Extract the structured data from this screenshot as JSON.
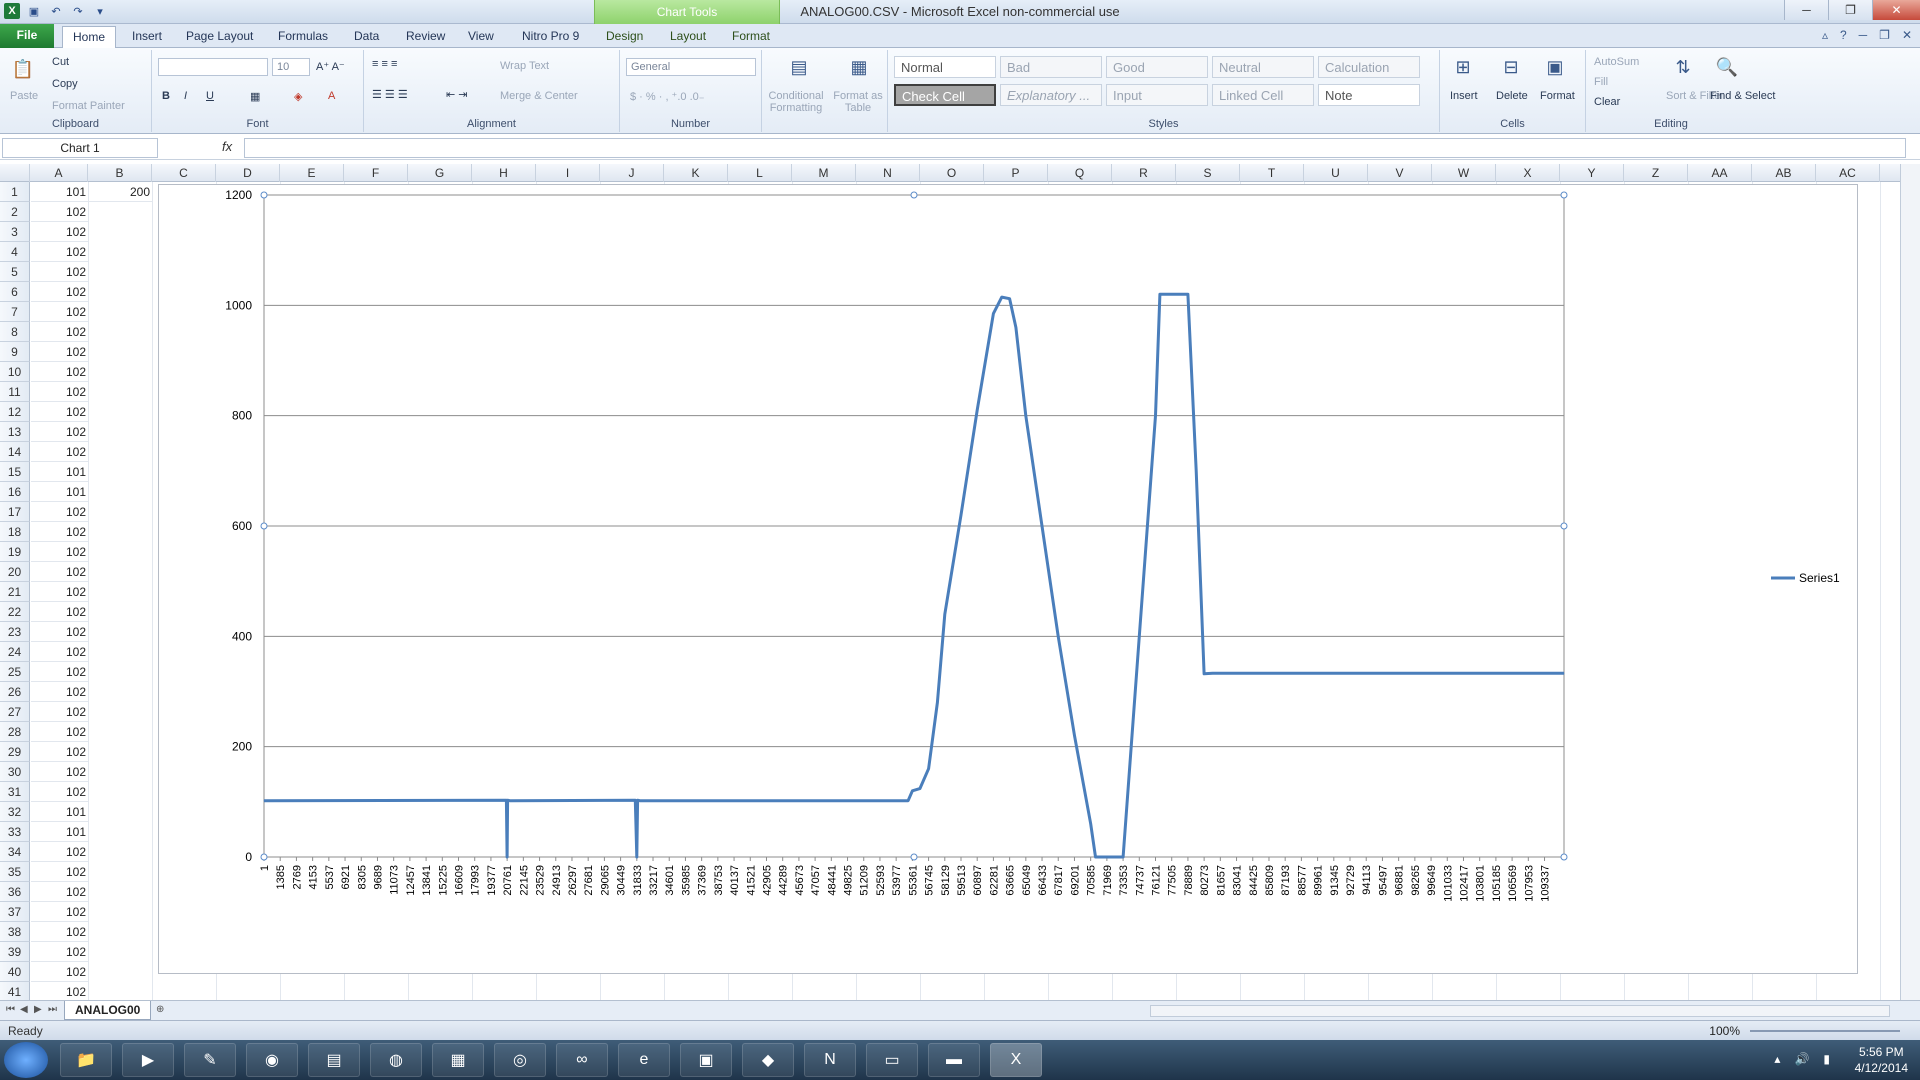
{
  "window": {
    "title": "ANALOG00.CSV - Microsoft Excel non-commercial use",
    "context_tab": "Chart Tools"
  },
  "tabs": [
    "File",
    "Home",
    "Insert",
    "Page Layout",
    "Formulas",
    "Data",
    "Review",
    "View",
    "Nitro Pro 9",
    "Design",
    "Layout",
    "Format"
  ],
  "ribbon": {
    "clipboard": {
      "label": "Clipboard",
      "paste": "Paste",
      "cut": "Cut",
      "copy": "Copy",
      "format_painter": "Format Painter"
    },
    "font": {
      "label": "Font",
      "size": "10"
    },
    "alignment": {
      "label": "Alignment",
      "wrap": "Wrap Text",
      "merge": "Merge & Center"
    },
    "number": {
      "label": "Number",
      "format": "General"
    },
    "cond_format": "Conditional Formatting",
    "format_table": "Format as Table",
    "styles": {
      "label": "Styles",
      "cells": [
        "Normal",
        "Bad",
        "Good",
        "Neutral",
        "Calculation",
        "Check Cell",
        "Explanatory ...",
        "Input",
        "Linked Cell",
        "Note"
      ]
    },
    "cells": {
      "label": "Cells",
      "insert": "Insert",
      "delete": "Delete",
      "format": "Format"
    },
    "editing": {
      "label": "Editing",
      "autosum": "AutoSum",
      "fill": "Fill",
      "clear": "Clear",
      "sort": "Sort & Filter",
      "find": "Find & Select"
    }
  },
  "formula_bar": {
    "name_box": "Chart 1",
    "fx": "fx",
    "value": ""
  },
  "columns": [
    "A",
    "B",
    "C",
    "D",
    "E",
    "F",
    "G",
    "H",
    "I",
    "J",
    "K",
    "L",
    "M",
    "N",
    "O",
    "P",
    "Q",
    "R",
    "S",
    "T",
    "U",
    "V",
    "W",
    "X",
    "Y",
    "Z",
    "AA",
    "AB",
    "AC"
  ],
  "rows": [
    {
      "n": "1",
      "a": "101",
      "b": "200"
    },
    {
      "n": "2",
      "a": "102"
    },
    {
      "n": "3",
      "a": "102"
    },
    {
      "n": "4",
      "a": "102"
    },
    {
      "n": "5",
      "a": "102"
    },
    {
      "n": "6",
      "a": "102"
    },
    {
      "n": "7",
      "a": "102"
    },
    {
      "n": "8",
      "a": "102"
    },
    {
      "n": "9",
      "a": "102"
    },
    {
      "n": "10",
      "a": "102"
    },
    {
      "n": "11",
      "a": "102"
    },
    {
      "n": "12",
      "a": "102"
    },
    {
      "n": "13",
      "a": "102"
    },
    {
      "n": "14",
      "a": "102"
    },
    {
      "n": "15",
      "a": "101"
    },
    {
      "n": "16",
      "a": "101"
    },
    {
      "n": "17",
      "a": "102"
    },
    {
      "n": "18",
      "a": "102"
    },
    {
      "n": "19",
      "a": "102"
    },
    {
      "n": "20",
      "a": "102"
    },
    {
      "n": "21",
      "a": "102"
    },
    {
      "n": "22",
      "a": "102"
    },
    {
      "n": "23",
      "a": "102"
    },
    {
      "n": "24",
      "a": "102"
    },
    {
      "n": "25",
      "a": "102"
    },
    {
      "n": "26",
      "a": "102"
    },
    {
      "n": "27",
      "a": "102"
    },
    {
      "n": "28",
      "a": "102"
    },
    {
      "n": "29",
      "a": "102"
    },
    {
      "n": "30",
      "a": "102"
    },
    {
      "n": "31",
      "a": "102"
    },
    {
      "n": "32",
      "a": "101"
    },
    {
      "n": "33",
      "a": "101"
    },
    {
      "n": "34",
      "a": "102"
    },
    {
      "n": "35",
      "a": "102"
    },
    {
      "n": "36",
      "a": "102"
    },
    {
      "n": "37",
      "a": "102"
    },
    {
      "n": "38",
      "a": "102"
    },
    {
      "n": "39",
      "a": "102"
    },
    {
      "n": "40",
      "a": "102"
    },
    {
      "n": "41",
      "a": "102"
    }
  ],
  "sheet_tab": "ANALOG00",
  "status": {
    "ready": "Ready",
    "zoom": "100%"
  },
  "clock": {
    "time": "5:56 PM",
    "date": "4/12/2014"
  },
  "colors": {
    "series": "#4a7ebb",
    "accent": "#1e7a30"
  },
  "chart_data": {
    "type": "line",
    "title": "",
    "xlabel": "",
    "ylabel": "",
    "ylim": [
      0,
      1200
    ],
    "yticks": [
      0,
      200,
      400,
      600,
      800,
      1000,
      1200
    ],
    "xlim": [
      1,
      111000
    ],
    "x_tick_labels": [
      "1",
      "1385",
      "2769",
      "4153",
      "5537",
      "6921",
      "8305",
      "9689",
      "11073",
      "12457",
      "13841",
      "15225",
      "16609",
      "17993",
      "19377",
      "20761",
      "22145",
      "23529",
      "24913",
      "26297",
      "27681",
      "29065",
      "30449",
      "31833",
      "33217",
      "34601",
      "35985",
      "37369",
      "38753",
      "40137",
      "41521",
      "42905",
      "44289",
      "45673",
      "47057",
      "48441",
      "49825",
      "51209",
      "52593",
      "53977",
      "55361",
      "56745",
      "58129",
      "59513",
      "60897",
      "62281",
      "63665",
      "65049",
      "66433",
      "67817",
      "69201",
      "70585",
      "71969",
      "73353",
      "74737",
      "76121",
      "77505",
      "78889",
      "80273",
      "81657",
      "83041",
      "84425",
      "85809",
      "87193",
      "88577",
      "89961",
      "91345",
      "92729",
      "94113",
      "95497",
      "96881",
      "98265",
      "99649",
      "101033",
      "102417",
      "103801",
      "105185",
      "106569",
      "107953",
      "109337"
    ],
    "legend_position": "right",
    "series": [
      {
        "name": "Series1",
        "x": [
          1,
          20700,
          20761,
          20800,
          21000,
          31700,
          31833,
          31900,
          32100,
          55000,
          55361,
          56000,
          56745,
          57500,
          58129,
          59513,
          60897,
          62281,
          63000,
          63665,
          64200,
          65049,
          66433,
          67817,
          69201,
          70585,
          71000,
          71969,
          73353,
          74737,
          76121,
          76500,
          78200,
          78889,
          79600,
          80273,
          81000,
          111000
        ],
        "values": [
          102,
          103,
          0,
          103,
          102,
          103,
          0,
          103,
          102,
          102,
          120,
          124,
          160,
          280,
          440,
          620,
          810,
          985,
          1015,
          1012,
          960,
          800,
          600,
          400,
          220,
          60,
          0,
          0,
          0,
          400,
          800,
          1020,
          1020,
          1020,
          700,
          332,
          333,
          333
        ]
      }
    ]
  }
}
